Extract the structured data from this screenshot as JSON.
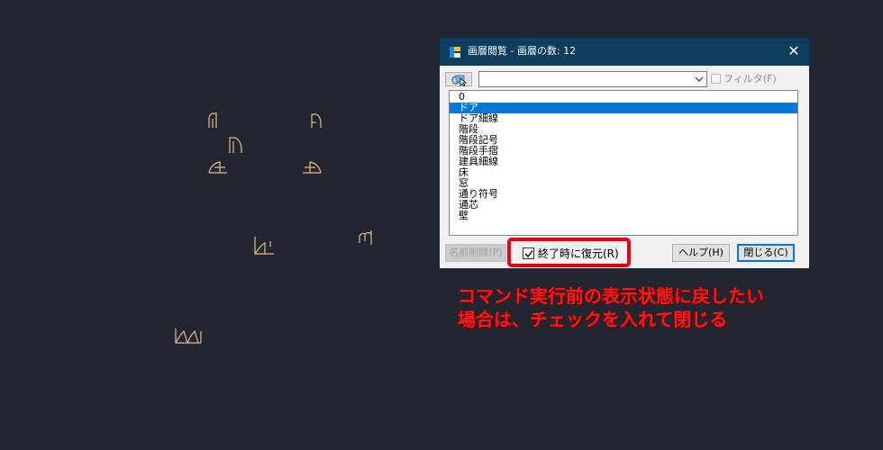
{
  "dialog": {
    "title": "画層閲覧 - 画層の数: 12",
    "filter_label": "フィルタ(F)",
    "combo_value": "",
    "layers": [
      "0",
      "ドア",
      "ドア細線",
      "階段",
      "階段記号",
      "階段手摺",
      "建具細線",
      "床",
      "窓",
      "通り符号",
      "通芯",
      "壁"
    ],
    "selected_index": 1,
    "delete_label": "名前削除(P)",
    "restore_label": "終了時に復元(R)",
    "restore_checked": true,
    "help_label": "ヘルプ(H)",
    "close_label": "閉じる(C)"
  },
  "annotation": {
    "line1": "コマンド実行前の表示状態に戻したい",
    "line2": "場合は、チェックを入れて閉じる"
  },
  "colors": {
    "canvas_bg": "#222631",
    "door_lines": "#e8b88a",
    "title_bar": "#0b3d5c",
    "selection": "#0078d7",
    "annotation": "#ff1a1a",
    "highlight": "#e50012"
  }
}
